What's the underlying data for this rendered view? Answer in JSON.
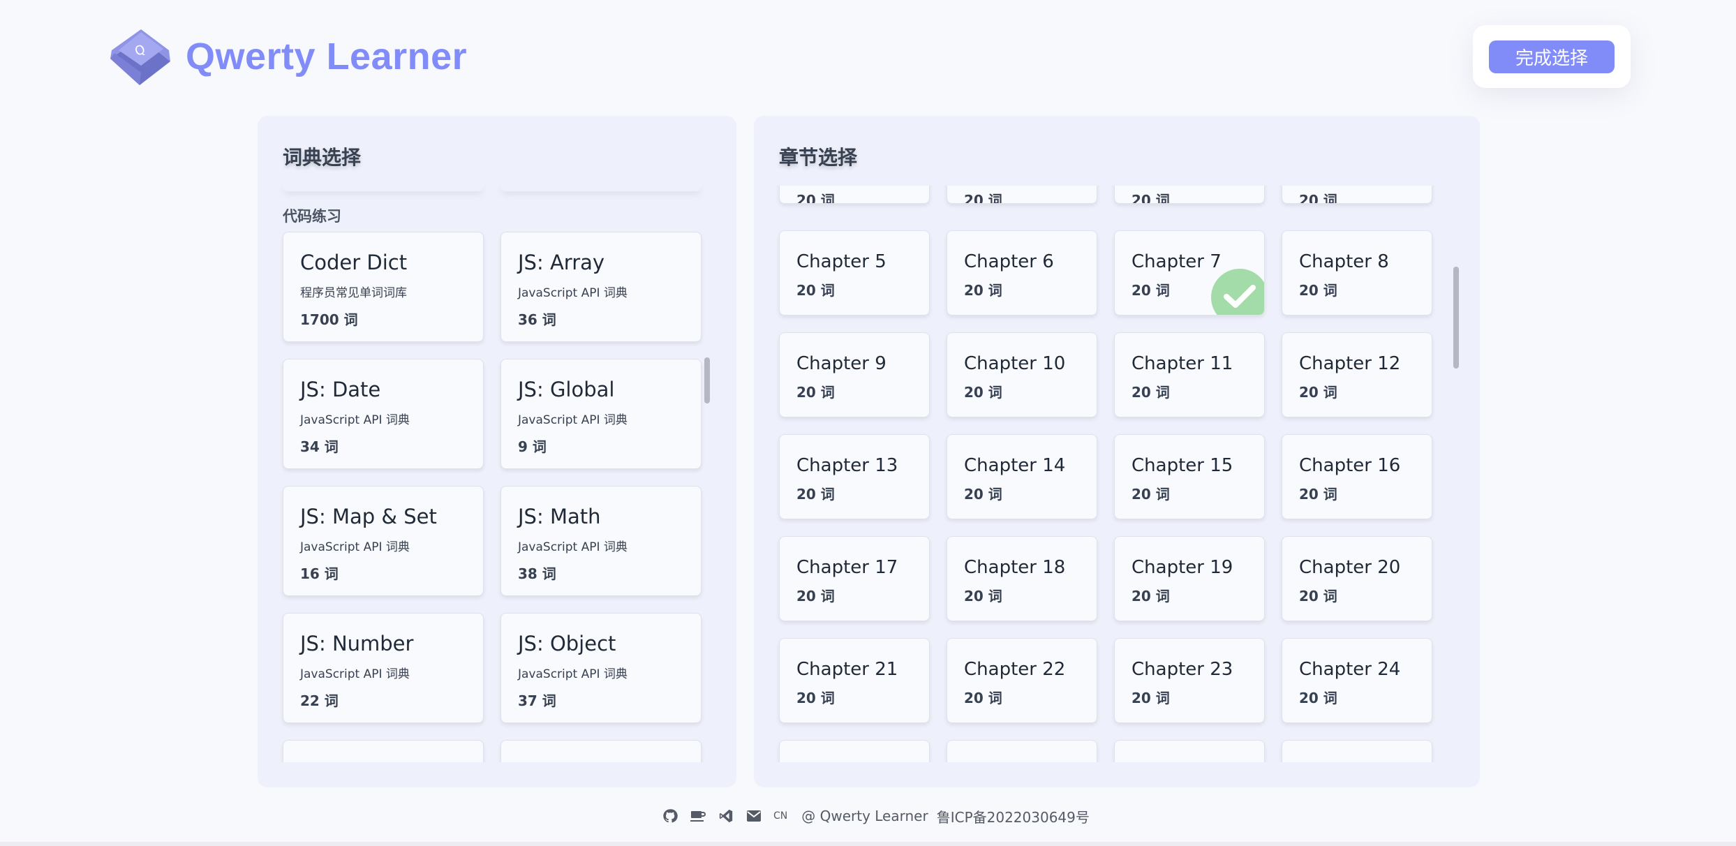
{
  "app": {
    "title": "Qwerty Learner"
  },
  "header": {
    "done_label": "完成选择"
  },
  "dict_panel": {
    "title": "词典选择",
    "group": "代码练习",
    "cards": [
      {
        "name": "Coder Dict",
        "desc": "程序员常见单词词库",
        "count": "1700 词"
      },
      {
        "name": "JS: Array",
        "desc": "JavaScript API 词典",
        "count": "36 词"
      },
      {
        "name": "JS: Date",
        "desc": "JavaScript API 词典",
        "count": "34 词"
      },
      {
        "name": "JS: Global",
        "desc": "JavaScript API 词典",
        "count": "9 词"
      },
      {
        "name": "JS: Map & Set",
        "desc": "JavaScript API 词典",
        "count": "16 词"
      },
      {
        "name": "JS: Math",
        "desc": "JavaScript API 词典",
        "count": "38 词"
      },
      {
        "name": "JS: Number",
        "desc": "JavaScript API 词典",
        "count": "22 词"
      },
      {
        "name": "JS: Object",
        "desc": "JavaScript API 词典",
        "count": "37 词"
      }
    ]
  },
  "chapter_panel": {
    "title": "章节选择",
    "partial_count": "20 词",
    "selected_index": 2,
    "chapters": [
      {
        "name": "Chapter 5",
        "count": "20 词"
      },
      {
        "name": "Chapter 6",
        "count": "20 词"
      },
      {
        "name": "Chapter 7",
        "count": "20 词"
      },
      {
        "name": "Chapter 8",
        "count": "20 词"
      },
      {
        "name": "Chapter 9",
        "count": "20 词"
      },
      {
        "name": "Chapter 10",
        "count": "20 词"
      },
      {
        "name": "Chapter 11",
        "count": "20 词"
      },
      {
        "name": "Chapter 12",
        "count": "20 词"
      },
      {
        "name": "Chapter 13",
        "count": "20 词"
      },
      {
        "name": "Chapter 14",
        "count": "20 词"
      },
      {
        "name": "Chapter 15",
        "count": "20 词"
      },
      {
        "name": "Chapter 16",
        "count": "20 词"
      },
      {
        "name": "Chapter 17",
        "count": "20 词"
      },
      {
        "name": "Chapter 18",
        "count": "20 词"
      },
      {
        "name": "Chapter 19",
        "count": "20 词"
      },
      {
        "name": "Chapter 20",
        "count": "20 词"
      },
      {
        "name": "Chapter 21",
        "count": "20 词"
      },
      {
        "name": "Chapter 22",
        "count": "20 词"
      },
      {
        "name": "Chapter 23",
        "count": "20 词"
      },
      {
        "name": "Chapter 24",
        "count": "20 词"
      }
    ]
  },
  "footer": {
    "cn": "CN",
    "copyright": "@ Qwerty Learner",
    "icp": "鲁ICP备2022030649号"
  },
  "colors": {
    "accent": "#818cf8",
    "check": "#a3dca8",
    "panel": "#eef0fb"
  }
}
